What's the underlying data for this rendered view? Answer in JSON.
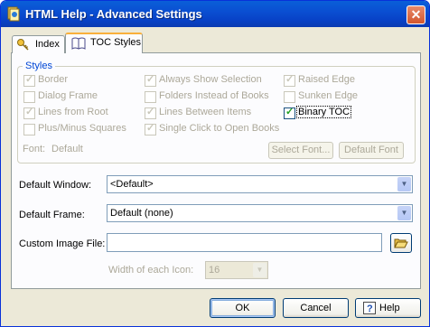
{
  "window": {
    "title": "HTML Help - Advanced Settings",
    "close_glyph": "✕"
  },
  "tabs": [
    {
      "label": "Index",
      "icon": "key-icon",
      "active": false
    },
    {
      "label": "TOC Styles",
      "icon": "book-icon",
      "active": true
    }
  ],
  "styles_group": {
    "label": "Styles",
    "options": [
      {
        "label": "Border",
        "checked": true,
        "enabled": false
      },
      {
        "label": "Dialog Frame",
        "checked": false,
        "enabled": false
      },
      {
        "label": "Lines from Root",
        "checked": true,
        "enabled": false
      },
      {
        "label": "Plus/Minus Squares",
        "checked": false,
        "enabled": false
      },
      {
        "label": "Always Show Selection",
        "checked": true,
        "enabled": false
      },
      {
        "label": "Folders Instead of Books",
        "checked": false,
        "enabled": false
      },
      {
        "label": "Lines Between Items",
        "checked": true,
        "enabled": false
      },
      {
        "label": "Single Click to Open Books",
        "checked": true,
        "enabled": false
      },
      {
        "label": "Raised Edge",
        "checked": true,
        "enabled": false
      },
      {
        "label": "Sunken Edge",
        "checked": false,
        "enabled": false
      },
      {
        "label": "Binary TOC",
        "checked": true,
        "enabled": true
      }
    ],
    "font_label": "Font:",
    "font_value": "Default",
    "select_font_button": "Select Font...",
    "default_font_button": "Default Font"
  },
  "default_window": {
    "label": "Default Window:",
    "value": "<Default>"
  },
  "default_frame": {
    "label": "Default Frame:",
    "value": "Default (none)"
  },
  "custom_image": {
    "label": "Custom Image File:",
    "value": "",
    "browse_icon": "folder-open-icon"
  },
  "icon_width": {
    "label": "Width of each Icon:",
    "value": "16"
  },
  "buttons": {
    "ok": "OK",
    "cancel": "Cancel",
    "help": "Help",
    "help_icon": "help-question-icon"
  },
  "colors": {
    "titlebar": "#0a4fd2",
    "dialog_bg": "#ece9d8",
    "group_label": "#0046d5",
    "tab_highlight": "#f9b03b"
  }
}
